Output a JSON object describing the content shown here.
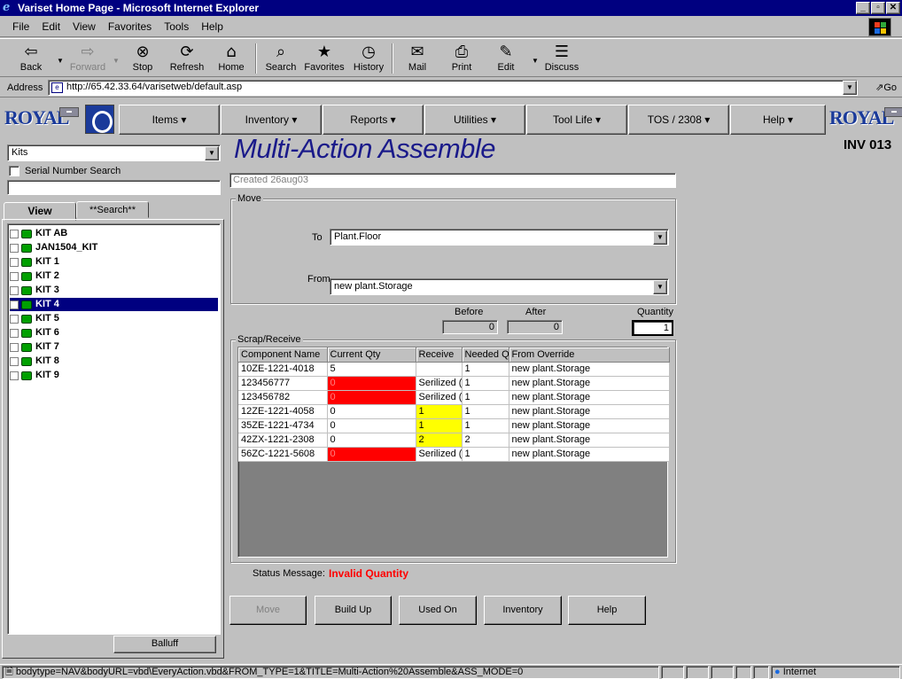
{
  "window": {
    "title": "Variset Home Page - Microsoft Internet Explorer"
  },
  "menu": [
    "File",
    "Edit",
    "View",
    "Favorites",
    "Tools",
    "Help"
  ],
  "toolbar": {
    "back": "Back",
    "forward": "Forward",
    "stop": "Stop",
    "refresh": "Refresh",
    "home": "Home",
    "search": "Search",
    "favorites": "Favorites",
    "history": "History",
    "mail": "Mail",
    "print": "Print",
    "edit": "Edit",
    "discuss": "Discuss"
  },
  "address": {
    "label": "Address",
    "url": "http://65.42.33.64/varisetweb/default.asp",
    "go": "Go"
  },
  "nav": {
    "items": [
      "Items",
      "Inventory",
      "Reports",
      "Utilities",
      "Tool Life",
      "TOS / 2308",
      "Help"
    ],
    "logo_text": "ROYAL"
  },
  "left": {
    "kit_select": "Kits",
    "serial_search_label": "Serial Number Search",
    "tabs": {
      "view": "View",
      "search": "**Search**"
    },
    "kits": [
      "KIT AB",
      "JAN1504_KIT",
      "KIT 1",
      "KIT 2",
      "KIT 3",
      "KIT 4",
      "KIT 5",
      "KIT 6",
      "KIT 7",
      "KIT 8",
      "KIT 9"
    ],
    "selected_kit": "KIT 4",
    "balluff": "Balluff"
  },
  "main": {
    "title": "Multi-Action Assemble",
    "code": "INV 013",
    "created": "Created 26aug03",
    "move": {
      "label": "Move",
      "to_label": "To",
      "to_value": "Plant.Floor",
      "from_label": "From",
      "from_value": "new plant.Storage"
    },
    "counts": {
      "before_label": "Before",
      "before": "0",
      "after_label": "After",
      "after": "0",
      "quantity_label": "Quantity",
      "quantity": "1"
    },
    "scrap": {
      "label": "Scrap/Receive",
      "columns": [
        "Component Name",
        "Current Qty",
        "Receive",
        "Needed Q",
        "From Override"
      ],
      "rows": [
        {
          "name": "10ZE-1221-4018",
          "qty": "5",
          "receive": "",
          "needed": "1",
          "from": "new plant.Storage",
          "qty_color": "",
          "rec_color": ""
        },
        {
          "name": "123456777",
          "qty": "0",
          "receive": "Serilized (s",
          "needed": "1",
          "from": "new plant.Storage",
          "qty_color": "red",
          "rec_color": ""
        },
        {
          "name": "123456782",
          "qty": "0",
          "receive": "Serilized (s",
          "needed": "1",
          "from": "new plant.Storage",
          "qty_color": "red",
          "rec_color": ""
        },
        {
          "name": "12ZE-1221-4058",
          "qty": "0",
          "receive": "1",
          "needed": "1",
          "from": "new plant.Storage",
          "qty_color": "",
          "rec_color": "yel"
        },
        {
          "name": "35ZE-1221-4734",
          "qty": "0",
          "receive": "1",
          "needed": "1",
          "from": "new plant.Storage",
          "qty_color": "",
          "rec_color": "yel"
        },
        {
          "name": "42ZX-1221-2308",
          "qty": "0",
          "receive": "2",
          "needed": "2",
          "from": "new plant.Storage",
          "qty_color": "",
          "rec_color": "yel"
        },
        {
          "name": "56ZC-1221-5608",
          "qty": "0",
          "receive": "Serilized (s",
          "needed": "1",
          "from": "new plant.Storage",
          "qty_color": "red",
          "rec_color": ""
        }
      ]
    },
    "status": {
      "label": "Status Message:",
      "message": "Invalid Quantity"
    },
    "buttons": {
      "move": "Move",
      "build_up": "Build Up",
      "used_on": "Used On",
      "inventory": "Inventory",
      "help": "Help"
    }
  },
  "statusbar": {
    "text": "bodytype=NAV&bodyURL=vbd\\EveryAction.vbd&FROM_TYPE=1&TITLE=Multi-Action%20Assemble&ASS_MODE=0",
    "zone": "Internet"
  }
}
